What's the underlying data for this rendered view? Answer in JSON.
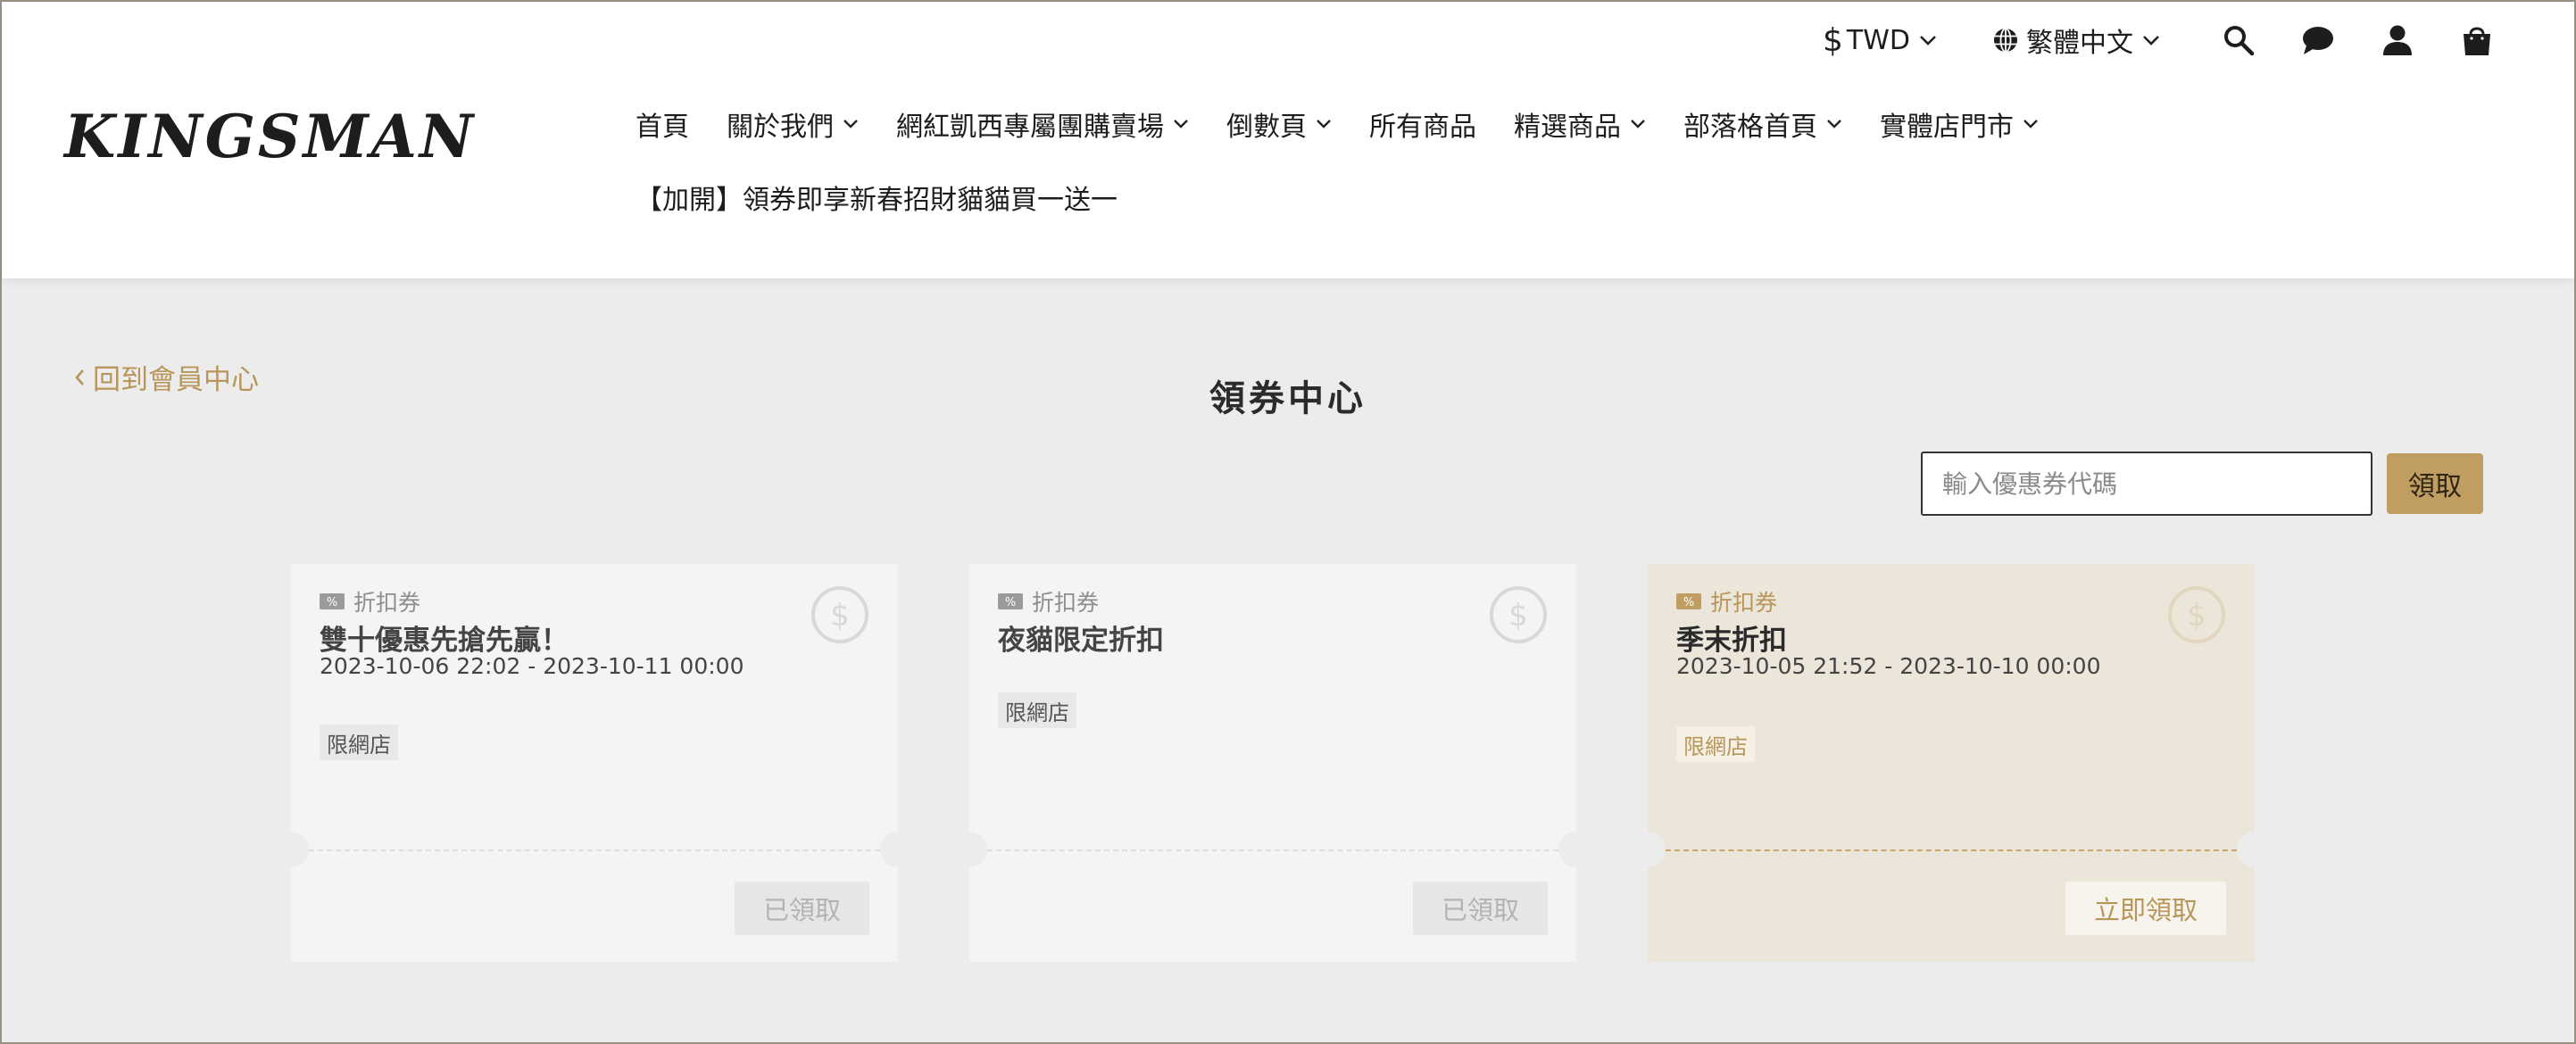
{
  "header": {
    "logo": "KINGSMAN",
    "currency": "TWD",
    "currency_symbol": "$",
    "language": "繁體中文",
    "icons": [
      "search-icon",
      "chat-icon",
      "user-icon",
      "cart-icon"
    ]
  },
  "nav": {
    "items": [
      {
        "label": "首頁"
      },
      {
        "label": "關於我們"
      },
      {
        "label": "網紅凱西專屬團購賣場"
      },
      {
        "label": "倒數頁"
      },
      {
        "label": "所有商品"
      },
      {
        "label": "精選商品"
      },
      {
        "label": "部落格首頁"
      },
      {
        "label": "實體店門市"
      }
    ],
    "row2": "【加開】領券即享新春招財貓貓買一送一"
  },
  "main": {
    "back_label": "回到會員中心",
    "title": "領券中心",
    "code_placeholder": "輸入優惠券代碼",
    "redeem_label": "領取"
  },
  "coupons": [
    {
      "type": "折扣券",
      "title": "雙十優惠先搶先贏！",
      "period": "2023-10-06 22:02 - 2023-10-11 00:00",
      "channel": "限網店",
      "action": "已領取",
      "status": "claimed"
    },
    {
      "type": "折扣券",
      "title": "夜貓限定折扣",
      "period": "",
      "channel": "限網店",
      "action": "已領取",
      "status": "claimed"
    },
    {
      "type": "折扣券",
      "title": "季末折扣",
      "period": "2023-10-05 21:52 - 2023-10-10 00:00",
      "channel": "限網店",
      "action": "立即領取",
      "status": "available"
    }
  ],
  "colors": {
    "accent": "#c09e62",
    "accent_text": "#b8965a",
    "page_bg": "#ececec"
  }
}
